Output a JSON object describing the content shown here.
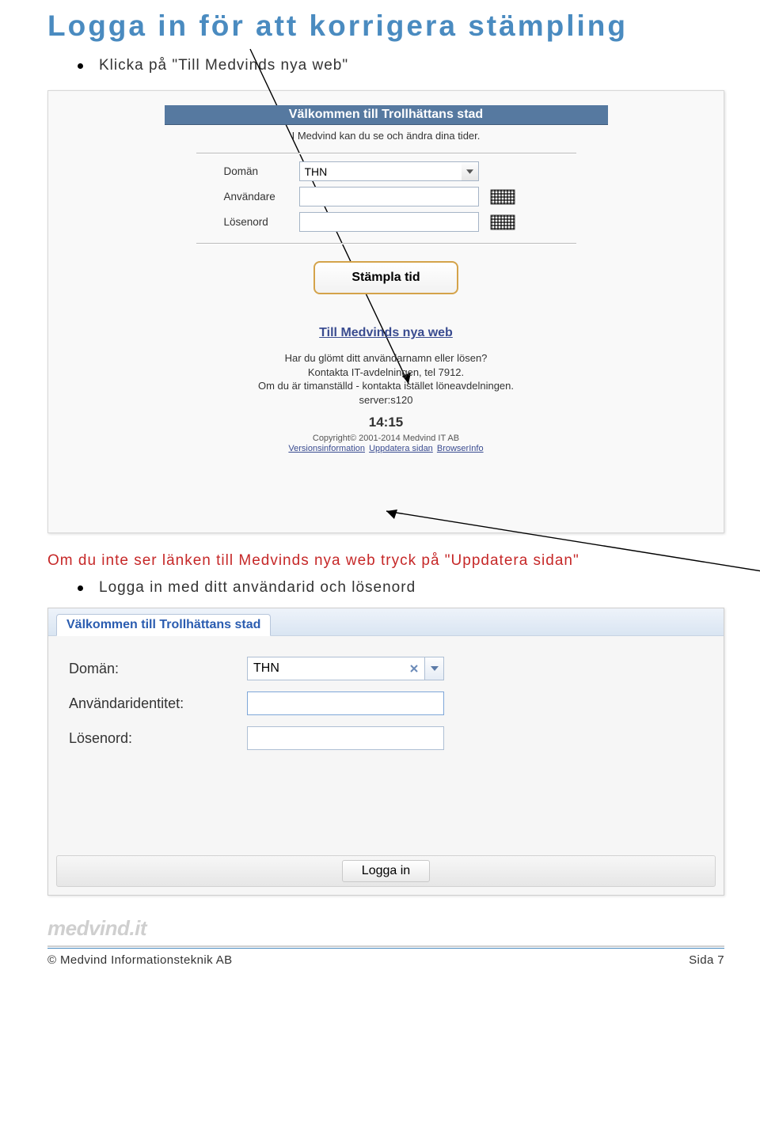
{
  "page": {
    "title": "Logga in för att korrigera stämpling",
    "bullet1": "Klicka på \"Till Medvinds nya web\"",
    "tip_red": "Om du inte ser länken till Medvinds nya web tryck på \"Uppdatera sidan\"",
    "bullet2": "Logga in med ditt användarid och lösenord"
  },
  "s1": {
    "banner": "Välkommen till Trollhättans stad",
    "intro": "I Medvind kan du se och ändra dina tider.",
    "labels": {
      "domain": "Domän",
      "user": "Användare",
      "pass": "Lösenord"
    },
    "domain_value": "THN",
    "stamp_btn": "Stämpla tid",
    "big_link": "Till Medvinds nya web",
    "help_l1": "Har du glömt ditt användarnamn eller lösen?",
    "help_l2": "Kontakta IT-avdelningen, tel 7912.",
    "help_l3": "Om du är timanställd - kontakta istället löneavdelningen.",
    "help_l4": "server:s120",
    "time": "14:15",
    "copyright": "Copyright© 2001-2014 Medvind IT AB",
    "link_version": "Versionsinformation",
    "link_update": "Uppdatera sidan",
    "link_browser": "BrowserInfo"
  },
  "s2": {
    "tab": "Välkommen till Trollhättans stad",
    "labels": {
      "domain": "Domän:",
      "user": "Användaridentitet:",
      "pass": "Lösenord:"
    },
    "domain_value": "THN",
    "login_btn": "Logga in"
  },
  "footer": {
    "watermark": "medvind.it",
    "company": "© Medvind Informationsteknik AB",
    "page": "Sida 7"
  }
}
